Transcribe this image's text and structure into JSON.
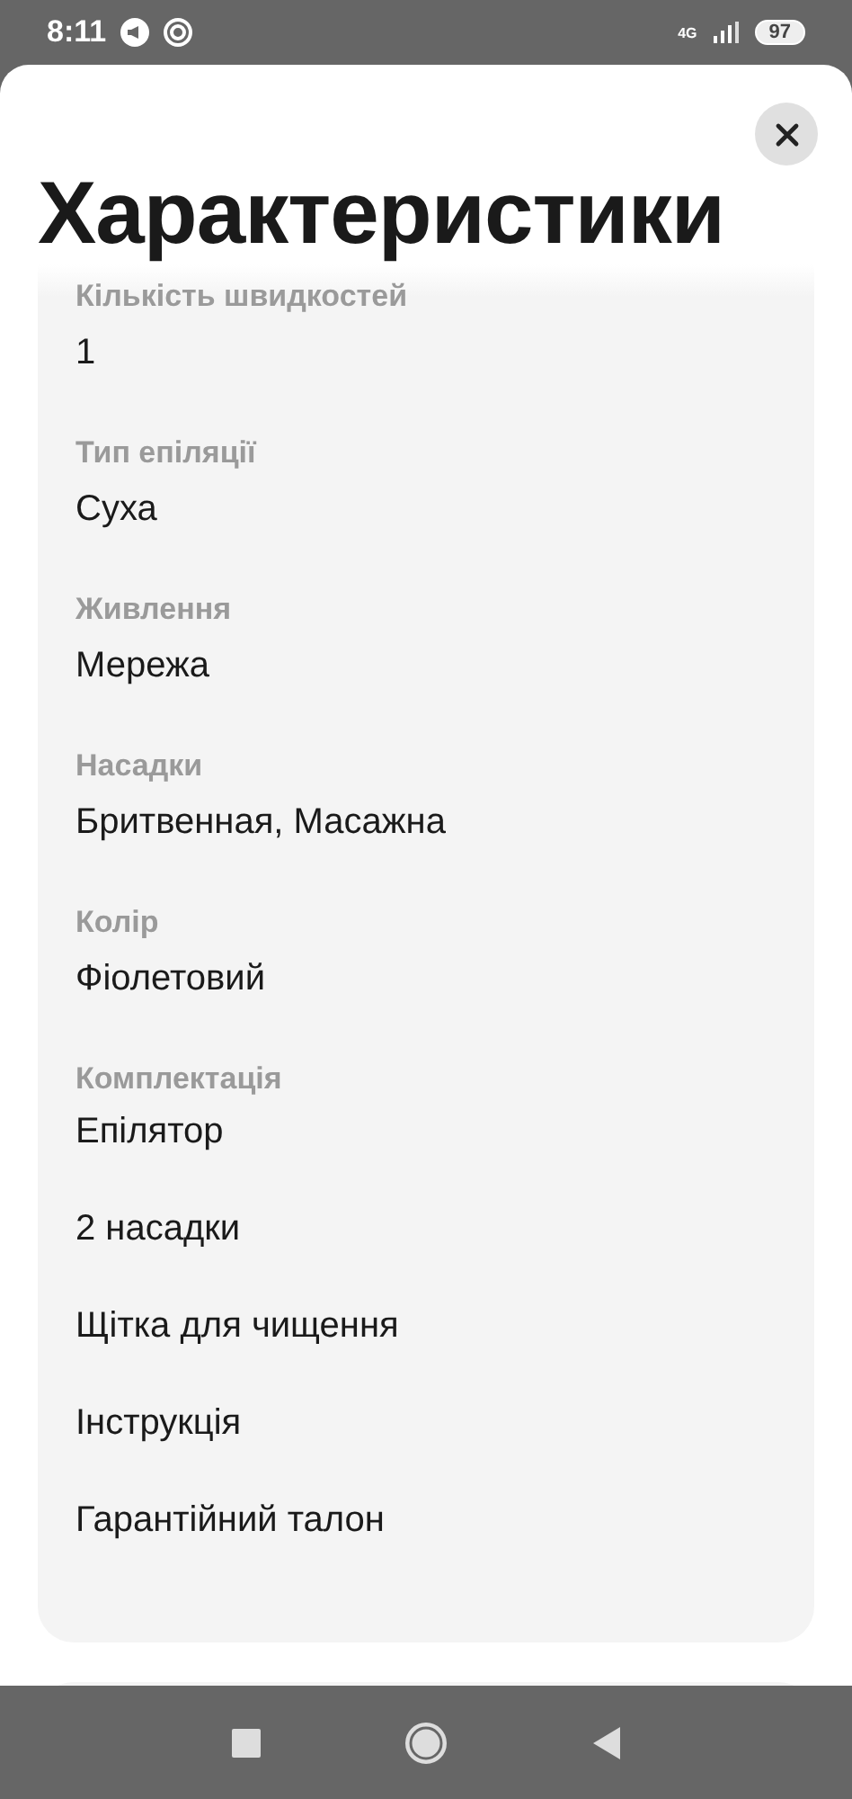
{
  "status_bar": {
    "time": "8:11",
    "network": "4G",
    "battery": "97"
  },
  "title": "Характеристики",
  "specs": [
    {
      "label": "Кількість швидкостей",
      "values": [
        "1"
      ]
    },
    {
      "label": "Тип епіляції",
      "values": [
        "Суха"
      ]
    },
    {
      "label": "Живлення",
      "values": [
        "Мережа"
      ]
    },
    {
      "label": "Насадки",
      "values": [
        "Бритвенная, Масажна"
      ]
    },
    {
      "label": "Колір",
      "values": [
        "Фіолетовий"
      ]
    },
    {
      "label": "Комплектація",
      "values": [
        "Епілятор",
        "2 насадки",
        "Щітка для чищення",
        "Інструкція",
        "Гарантійний талон"
      ]
    }
  ]
}
